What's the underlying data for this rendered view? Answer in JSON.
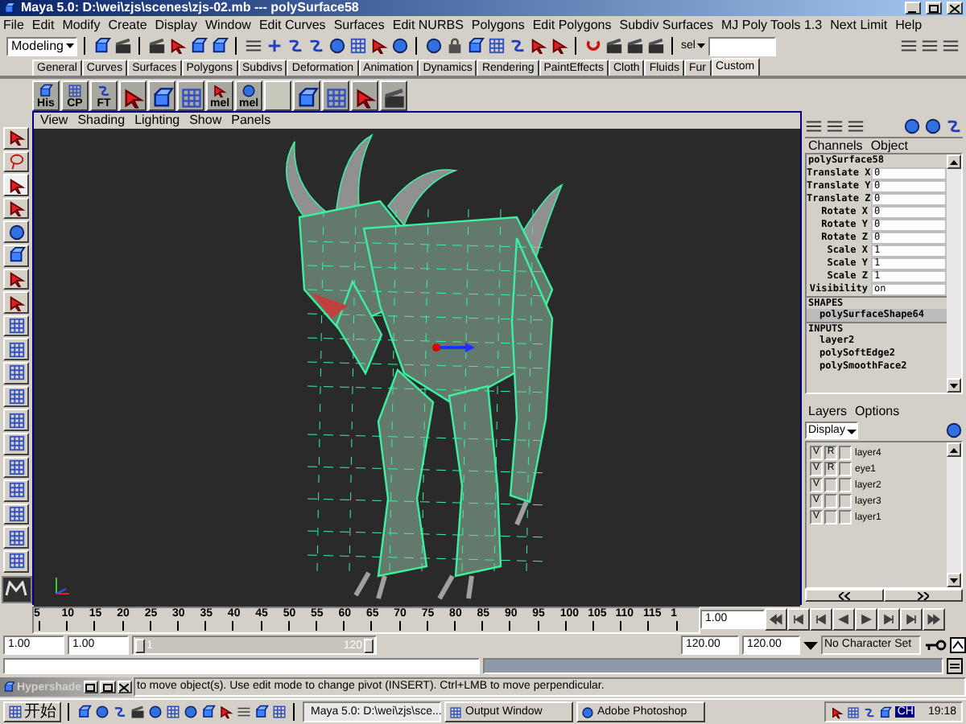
{
  "window": {
    "title": "Maya 5.0: D:\\wei\\zjs\\scenes\\zjs-02.mb  ---  polySurface58"
  },
  "menu_bar": [
    "File",
    "Edit",
    "Modify",
    "Create",
    "Display",
    "Window",
    "Edit Curves",
    "Surfaces",
    "Edit NURBS",
    "Polygons",
    "Edit Polygons",
    "Subdiv Surfaces",
    "MJ Poly Tools 1.3",
    "Next Limit",
    "Help"
  ],
  "status_line": {
    "mode": "Modeling",
    "quick_select": "sel"
  },
  "shelf": {
    "tabs": [
      {
        "label": "General",
        "selected": false
      },
      {
        "label": "Curves",
        "selected": false
      },
      {
        "label": "Surfaces",
        "selected": false
      },
      {
        "label": "Polygons",
        "selected": false
      },
      {
        "label": "Subdivs",
        "selected": false
      },
      {
        "label": "Deformation",
        "selected": false
      },
      {
        "label": "Animation",
        "selected": false
      },
      {
        "label": "Dynamics",
        "selected": false
      },
      {
        "label": "Rendering",
        "selected": false
      },
      {
        "label": "PaintEffects",
        "selected": false
      },
      {
        "label": "Cloth",
        "selected": false
      },
      {
        "label": "Fluids",
        "selected": false
      },
      {
        "label": "Fur",
        "selected": false
      },
      {
        "label": "Custom",
        "selected": true
      }
    ],
    "items": [
      {
        "kind": "labeled",
        "label": "His"
      },
      {
        "kind": "labeled",
        "label": "CP"
      },
      {
        "kind": "labeled",
        "label": "FT"
      },
      {
        "kind": "icon"
      },
      {
        "kind": "icon"
      },
      {
        "kind": "icon"
      },
      {
        "kind": "labeled",
        "label": "mel"
      },
      {
        "kind": "labeled",
        "label": "mel"
      },
      {
        "kind": "blank"
      },
      {
        "kind": "icon"
      },
      {
        "kind": "icon"
      },
      {
        "kind": "icon"
      },
      {
        "kind": "icon"
      }
    ]
  },
  "viewport": {
    "menus": [
      "View",
      "Shading",
      "Lighting",
      "Show",
      "Panels"
    ]
  },
  "channel_box": {
    "menus": [
      "Channels",
      "Object"
    ],
    "object": "polySurface58",
    "attributes": [
      {
        "name": "Translate X",
        "value": "0"
      },
      {
        "name": "Translate Y",
        "value": "0"
      },
      {
        "name": "Translate Z",
        "value": "0"
      },
      {
        "name": "Rotate X",
        "value": "0"
      },
      {
        "name": "Rotate Y",
        "value": "0"
      },
      {
        "name": "Rotate Z",
        "value": "0"
      },
      {
        "name": "Scale X",
        "value": "1"
      },
      {
        "name": "Scale Y",
        "value": "1"
      },
      {
        "name": "Scale Z",
        "value": "1"
      },
      {
        "name": "Visibility",
        "value": "on"
      }
    ],
    "shapes_heading": "SHAPES",
    "shapes": [
      "polySurfaceShape64"
    ],
    "inputs_heading": "INPUTS",
    "inputs": [
      "layer2",
      "polySoftEdge2",
      "polySmoothFace2"
    ]
  },
  "layer_editor": {
    "menus": [
      "Layers",
      "Options"
    ],
    "display": "Display",
    "layers": [
      {
        "name": "layer4",
        "visible_flag": "V",
        "type_flag": "R"
      },
      {
        "name": "eye1",
        "visible_flag": "V",
        "type_flag": "R"
      },
      {
        "name": "layer2",
        "visible_flag": "V"
      },
      {
        "name": "layer3",
        "visible_flag": "V"
      },
      {
        "name": "layer1",
        "visible_flag": "V"
      }
    ]
  },
  "time_slider": {
    "ticks": [
      "5",
      "10",
      "15",
      "20",
      "25",
      "30",
      "35",
      "40",
      "45",
      "50",
      "55",
      "60",
      "65",
      "70",
      "75",
      "80",
      "85",
      "90",
      "95",
      "100",
      "105",
      "110",
      "115",
      "1"
    ],
    "current_time": "1.00"
  },
  "range_slider": {
    "level": 1,
    "start": "1.00",
    "playback_start": "1.00",
    "range_start": "1",
    "range_end": "120",
    "playback_end": "120.00",
    "end": "120.00",
    "character_set": "No Character Set"
  },
  "help_line": {
    "text": "to move object(s). Use edit mode to change pivot (INSERT).  Ctrl+LMB to move perpendicular."
  },
  "minimized_window": {
    "title": "Hypershade"
  },
  "taskbar": {
    "start": "开始",
    "tasks": [
      {
        "label": "Maya 5.0: D:\\wei\\zjs\\sce...",
        "selected": true
      },
      {
        "label": "Output Window",
        "selected": false
      },
      {
        "label": "Adobe Photoshop",
        "selected": false
      }
    ],
    "language": "CH",
    "clock": "19:18"
  }
}
